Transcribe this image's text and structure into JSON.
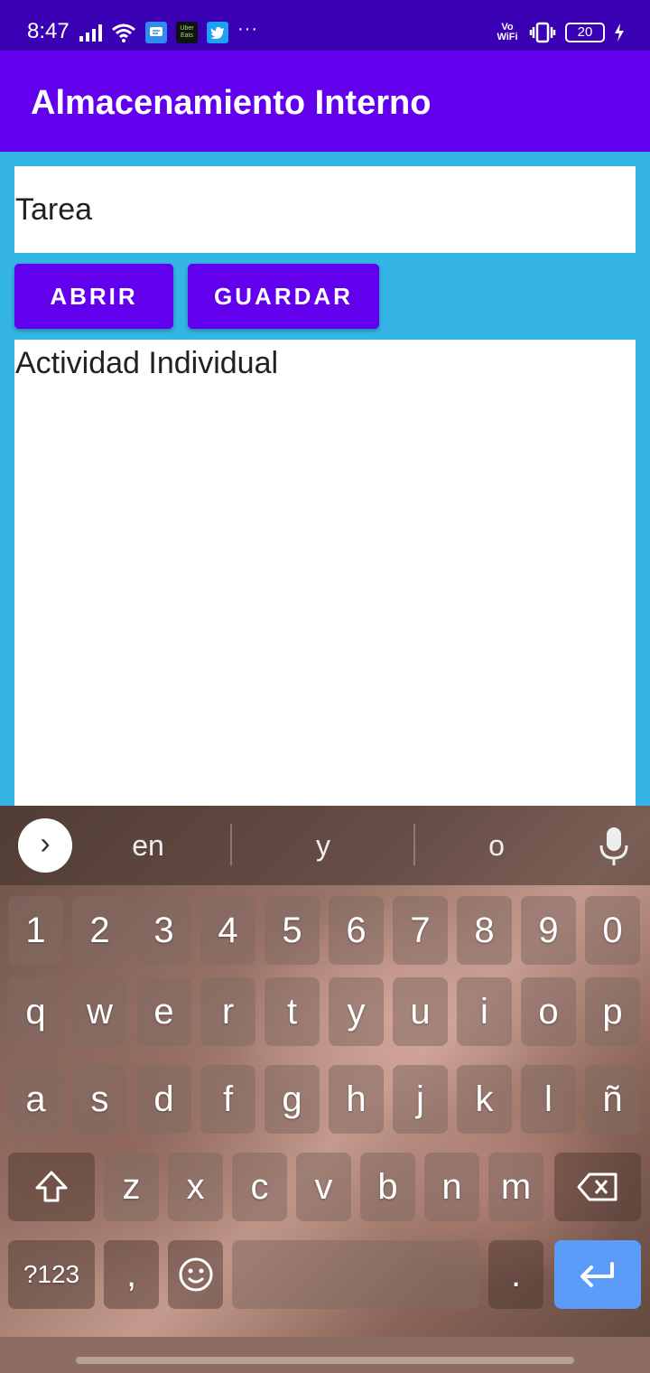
{
  "status_bar": {
    "time": "8:47",
    "notification_icons": [
      "message-icon",
      "uber-eats-icon",
      "twitter-icon"
    ],
    "uber_eats_label": "Uber Eats",
    "more": "···",
    "vowifi": "Vo WiFi",
    "battery_level": "20"
  },
  "app_bar": {
    "title": "Almacenamiento Interno",
    "color": "#6200ee"
  },
  "form": {
    "filename_value": "Tarea",
    "open_label": "ABRIR",
    "save_label": "GUARDAR",
    "content_value": "Actividad Individual",
    "background_color": "#35b4e6"
  },
  "keyboard": {
    "suggestions": [
      "en",
      "y",
      "o"
    ],
    "number_row": [
      "1",
      "2",
      "3",
      "4",
      "5",
      "6",
      "7",
      "8",
      "9",
      "0"
    ],
    "row1": [
      "q",
      "w",
      "e",
      "r",
      "t",
      "y",
      "u",
      "i",
      "o",
      "p"
    ],
    "row2": [
      "a",
      "s",
      "d",
      "f",
      "g",
      "h",
      "j",
      "k",
      "l",
      "ñ"
    ],
    "row3": [
      "z",
      "x",
      "c",
      "v",
      "b",
      "n",
      "m"
    ],
    "symbols_label": "?123",
    "comma": ",",
    "period": ".",
    "enter_color": "#5b9cf8"
  }
}
